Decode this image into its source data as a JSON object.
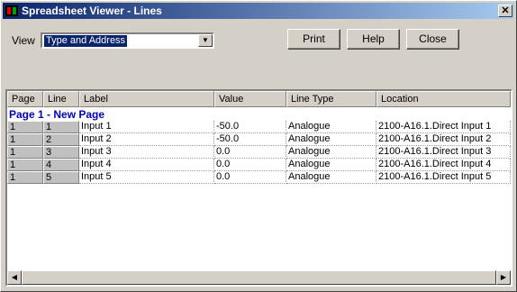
{
  "window": {
    "title": "Spreadsheet Viewer - Lines",
    "close_glyph": "✕"
  },
  "view": {
    "label": "View",
    "selected": "Type and Address",
    "dropdown_glyph": "▼"
  },
  "buttons": {
    "print": "Print",
    "help": "Help",
    "close": "Close"
  },
  "table": {
    "headers": {
      "page": "Page",
      "line": "Line",
      "label": "Label",
      "value": "Value",
      "line_type": "Line Type",
      "location": "Location"
    },
    "group_title": "Page 1 - New Page",
    "rows": [
      {
        "page": "1",
        "line": "1",
        "label": "Input 1",
        "value": "-50.0",
        "line_type": "Analogue",
        "location": "2100-A16.1.Direct Input 1"
      },
      {
        "page": "1",
        "line": "2",
        "label": "Input 2",
        "value": "-50.0",
        "line_type": "Analogue",
        "location": "2100-A16.1.Direct Input 2"
      },
      {
        "page": "1",
        "line": "3",
        "label": "Input 3",
        "value": "0.0",
        "line_type": "Analogue",
        "location": "2100-A16.1.Direct Input 3"
      },
      {
        "page": "1",
        "line": "4",
        "label": "Input 4",
        "value": "0.0",
        "line_type": "Analogue",
        "location": "2100-A16.1.Direct Input 4"
      },
      {
        "page": "1",
        "line": "5",
        "label": "Input 5",
        "value": "0.0",
        "line_type": "Analogue",
        "location": "2100-A16.1.Direct Input 5"
      }
    ]
  },
  "scrollbar": {
    "left_glyph": "◀",
    "right_glyph": "▶"
  },
  "colors": {
    "title_bar": "#0a246a",
    "group_title": "#0000c0",
    "selection": "#0a246a"
  }
}
